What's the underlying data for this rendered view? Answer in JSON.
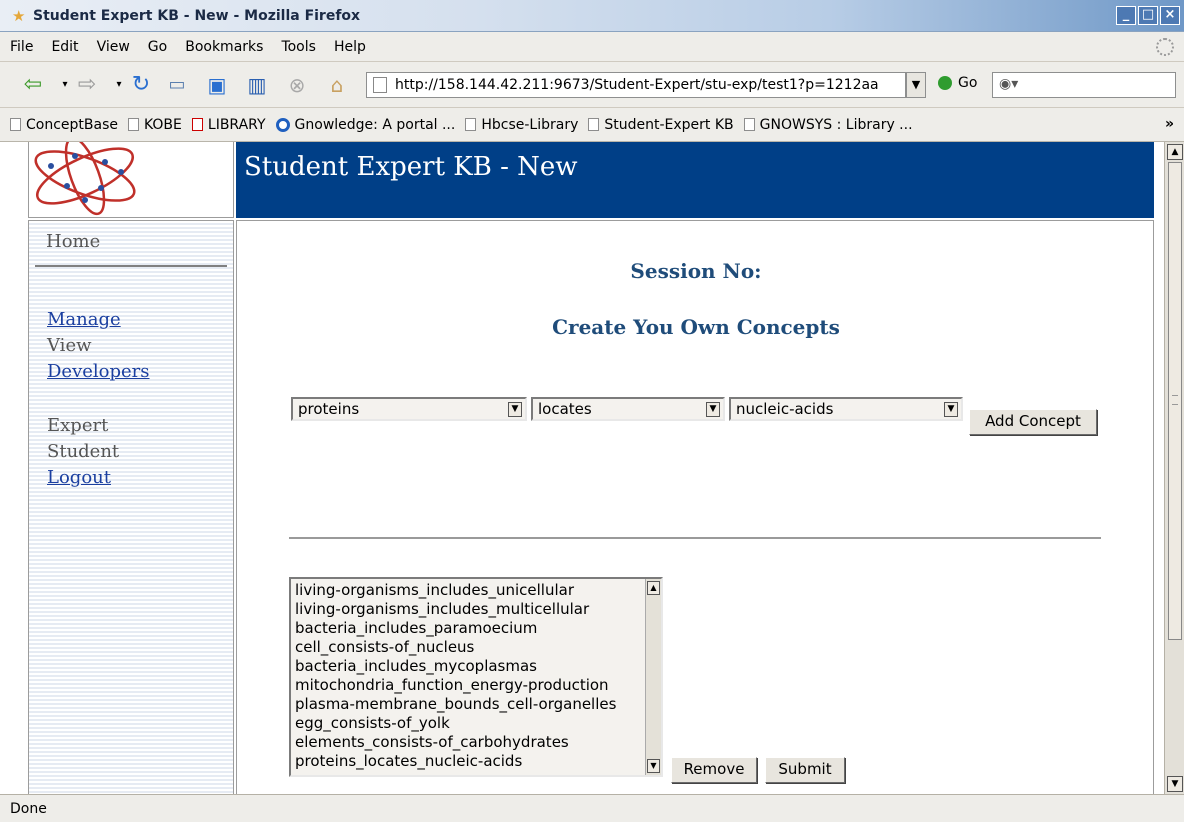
{
  "window": {
    "title": "Student Expert KB - New - Mozilla Firefox"
  },
  "menu": [
    "File",
    "Edit",
    "View",
    "Go",
    "Bookmarks",
    "Tools",
    "Help"
  ],
  "nav": {
    "url": "http://158.144.42.211:9673/Student-Expert/stu-exp/test1?p=1212aa",
    "go_label": "Go"
  },
  "bookmarks": [
    "ConceptBase",
    "KOBE",
    "LIBRARY",
    "Gnowledge: A portal ...",
    "Hbcse-Library",
    "Student-Expert KB",
    "GNOWSYS : Library ..."
  ],
  "bookmarks_more": "»",
  "page": {
    "banner_title": "Student Expert KB - New",
    "sidebar": {
      "home": "Home",
      "links": [
        "Manage",
        "View",
        "Developers",
        "Expert",
        "Student",
        "Logout"
      ]
    },
    "session_label": "Session No:",
    "create_heading": "Create You Own Concepts",
    "select_subject": "proteins",
    "select_relation": "locates",
    "select_object": "nucleic-acids",
    "add_concept_label": "Add Concept",
    "concepts": [
      "living-organisms_includes_unicellular",
      "living-organisms_includes_multicellular",
      "bacteria_includes_paramoecium",
      "cell_consists-of_nucleus",
      "bacteria_includes_mycoplasmas",
      "mitochondria_function_energy-production",
      "plasma-membrane_bounds_cell-organelles",
      "egg_consists-of_yolk",
      "elements_consists-of_carbohydrates",
      "proteins_locates_nucleic-acids"
    ],
    "remove_label": "Remove",
    "submit_label": "Submit"
  },
  "status": "Done"
}
